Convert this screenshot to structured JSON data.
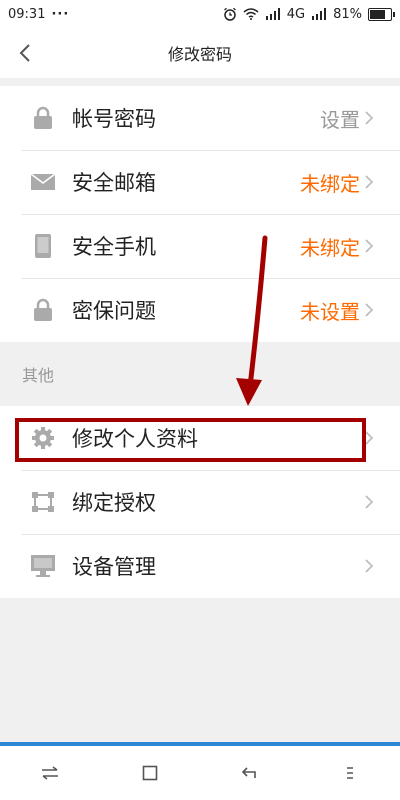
{
  "status_bar": {
    "time": "09:31",
    "dots": "···",
    "network": "4G",
    "battery": "81%",
    "battery_level": 0.81
  },
  "nav": {
    "title": "修改密码",
    "back_icon": "chevron-left-icon"
  },
  "security_items": [
    {
      "label": "帐号密码",
      "value": "设置",
      "value_color": "#999999",
      "icon": "lock-icon"
    },
    {
      "label": "安全邮箱",
      "value": "未绑定",
      "value_color": "#ff6a00",
      "icon": "mail-icon"
    },
    {
      "label": "安全手机",
      "value": "未绑定",
      "value_color": "#ff6a00",
      "icon": "phone-icon"
    },
    {
      "label": "密保问题",
      "value": "未设置",
      "value_color": "#ff6a00",
      "icon": "lock-icon"
    }
  ],
  "other_section": {
    "header": "其他",
    "items": [
      {
        "label": "修改个人资料",
        "icon": "gear-icon"
      },
      {
        "label": "绑定授权",
        "icon": "link-icon"
      },
      {
        "label": "设备管理",
        "icon": "monitor-icon"
      }
    ]
  },
  "colors": {
    "accent": "#2d86d6",
    "highlight": "#a30000",
    "warning": "#ff6a00"
  }
}
